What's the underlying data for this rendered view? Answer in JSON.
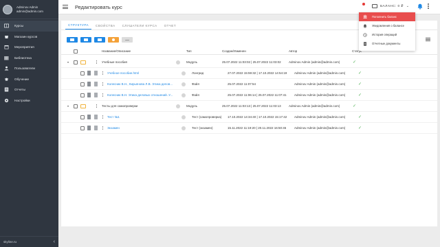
{
  "profile": {
    "name": "Adminov Admin",
    "email": "admin@admin.com"
  },
  "sidebar": {
    "items": [
      {
        "label": "Курсы",
        "icon": "courses-icon"
      },
      {
        "label": "Магазин курсов",
        "icon": "store-icon"
      },
      {
        "label": "Мероприятия",
        "icon": "calendar-icon"
      },
      {
        "label": "Библиотека",
        "icon": "library-icon"
      },
      {
        "label": "Пользователи",
        "icon": "users-icon"
      },
      {
        "label": "Обучение",
        "icon": "education-icon"
      },
      {
        "label": "Отчеты",
        "icon": "reports-icon"
      },
      {
        "label": "Настройки",
        "icon": "gear-icon"
      }
    ],
    "footer": "skyline.ru"
  },
  "header": {
    "title": "Редактировать курс",
    "balance": "БАЛАНС: 0 ₽"
  },
  "tabs": [
    "СТРУКТУРА",
    "СВОЙСТВА",
    "СЛУШАТЕЛИ КУРСА",
    "ОТЧЕТ"
  ],
  "table": {
    "columns": [
      "Название/Описание",
      "Тип",
      "Создан/Изменен",
      "Автор",
      "Статус"
    ],
    "rows": [
      {
        "name": "Учебные пособия",
        "type": "Модуль",
        "dates": "25.07.2022 11:03:02 | 25.07.2022 11:03:02",
        "author": "Adminov Admin (admin@admin.com)",
        "level": 0,
        "link": false
      },
      {
        "name": "Учебное пособие.html",
        "type": "Лонгрид",
        "dates": "27.07.2022 15:59:32 | 17.10.2022 14:54:19",
        "author": "Adminov Admin (admin@admin.com)",
        "level": 1,
        "link": true
      },
      {
        "name": "Колесник В.Н., Кирьянова Л.В. Этика делов...",
        "type": "Файл",
        "dates": "25.07.2022 11:07:54",
        "author": "Adminov Admin (admin@admin.com)",
        "level": 1,
        "link": true
      },
      {
        "name": "Колесник В.Н. Этика деловых отношений. У...",
        "type": "Файл",
        "dates": "25.07.2022 11:06:14 | 25.07.2022 11:07:41",
        "author": "Adminov Admin (admin@admin.com)",
        "level": 1,
        "link": true
      },
      {
        "name": "Тесты для самопроверки",
        "type": "Модуль",
        "dates": "25.07.2022 11:03:13 | 25.07.2022 11:03:13",
        "author": "Adminov Admin (admin@admin.com)",
        "level": 0,
        "link": false
      },
      {
        "name": "Тест №1",
        "type": "Тест (самопроверка)",
        "dates": "17.10.2022 14:34:40 | 17.10.2022 15:17:42",
        "author": "Adminov Admin (admin@admin.com)",
        "level": 1,
        "link": true
      },
      {
        "name": "Экзамен",
        "type": "Тест (экзамен)",
        "dates": "15.11.2022 11:19:20 | 20.11.2022 16:50:45",
        "author": "Adminov Admin (admin@admin.com)",
        "level": 1,
        "link": true
      }
    ]
  },
  "dropdown": {
    "items": [
      {
        "label": "Пополнить баланс",
        "icon": "bank-icon"
      },
      {
        "label": "Уведомления о балансе",
        "icon": "bell-icon"
      },
      {
        "label": "История операций",
        "icon": "history-icon"
      },
      {
        "label": "Отчетные документы",
        "icon": "document-icon"
      }
    ]
  },
  "colors": {
    "accent": "#1e88e5",
    "sidebar": "#2f3640",
    "primary_action": "#e84d4d",
    "toolbar_warning": "#f4a23a"
  }
}
